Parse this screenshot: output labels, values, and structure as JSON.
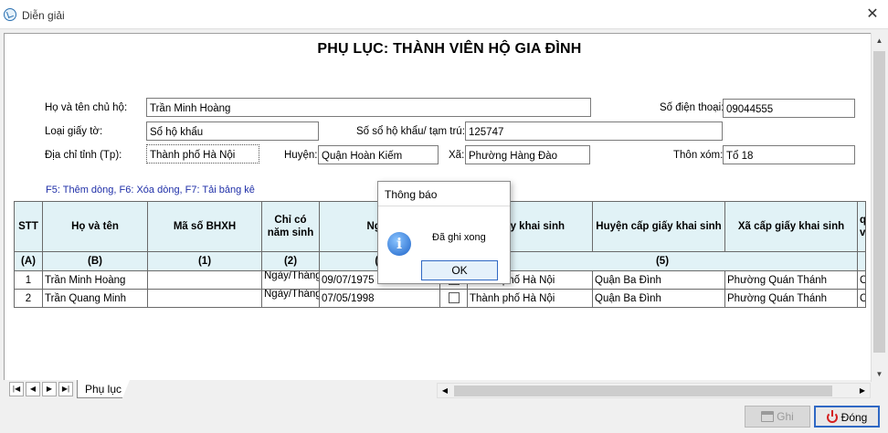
{
  "window": {
    "title": "Diễn giải",
    "close_glyph": "✕"
  },
  "document": {
    "title": "PHỤ LỤC: THÀNH VIÊN HỘ GIA ĐÌNH"
  },
  "form": {
    "head_name_label": "Họ và tên chủ hộ:",
    "head_name_value": "Trần Minh Hoàng",
    "phone_label": "Số điện thoại:",
    "phone_value": "09044555",
    "doc_type_label": "Loại giấy tờ:",
    "doc_type_value": "Sổ hộ khẩu",
    "book_no_label": "Số sổ hộ khẩu/ tạm trú:",
    "book_no_value": "125747",
    "province_label": "Địa chỉ tỉnh (Tp):",
    "province_value": "Thành phố Hà Nội",
    "district_label": "Huyện:",
    "district_value": "Quận Hoàn Kiếm",
    "commune_label": "Xã:",
    "commune_value": "Phường Hàng Đào",
    "hamlet_label": "Thôn xóm:",
    "hamlet_value": "Tổ 18"
  },
  "hint": "F5: Thêm dòng, F6: Xóa dòng, F7: Tải bảng kê",
  "table": {
    "headers": [
      "STT",
      "Họ và tên",
      "Mã số BHXH",
      "Chỉ có năm sinh",
      "Ngày",
      "",
      "giấy khai sinh",
      "Huyện cấp giấy khai sinh",
      "Xã cấp giấy khai sinh",
      "q vớ"
    ],
    "codes": [
      "(A)",
      "(B)",
      "(1)",
      "(2)",
      "(3",
      "",
      "(5)",
      ""
    ],
    "rows": [
      {
        "stt": "1",
        "name": "Trần Minh Hoàng",
        "bhxh": "",
        "year_only": "Ngày/Tháng/Năm",
        "dob": "09/07/1975",
        "province": "Thành phố Hà Nội",
        "district": "Quận Ba Đình",
        "commune": "Phường Quán Thánh",
        "extra": "Chi"
      },
      {
        "stt": "2",
        "name": "Trần Quang Minh",
        "bhxh": "",
        "year_only": "Ngày/Tháng/Năm",
        "dob": "07/05/1998",
        "province": "Thành phố Hà Nội",
        "district": "Quận Ba Đình",
        "commune": "Phường Quán Thánh",
        "extra": "Co"
      }
    ]
  },
  "sheet_tabs": [
    "Phụ lục"
  ],
  "buttons": {
    "save": "Ghi",
    "close": "Đóng"
  },
  "dialog": {
    "title": "Thông báo",
    "icon": "i",
    "message": "Đã ghi xong",
    "ok": "OK"
  }
}
